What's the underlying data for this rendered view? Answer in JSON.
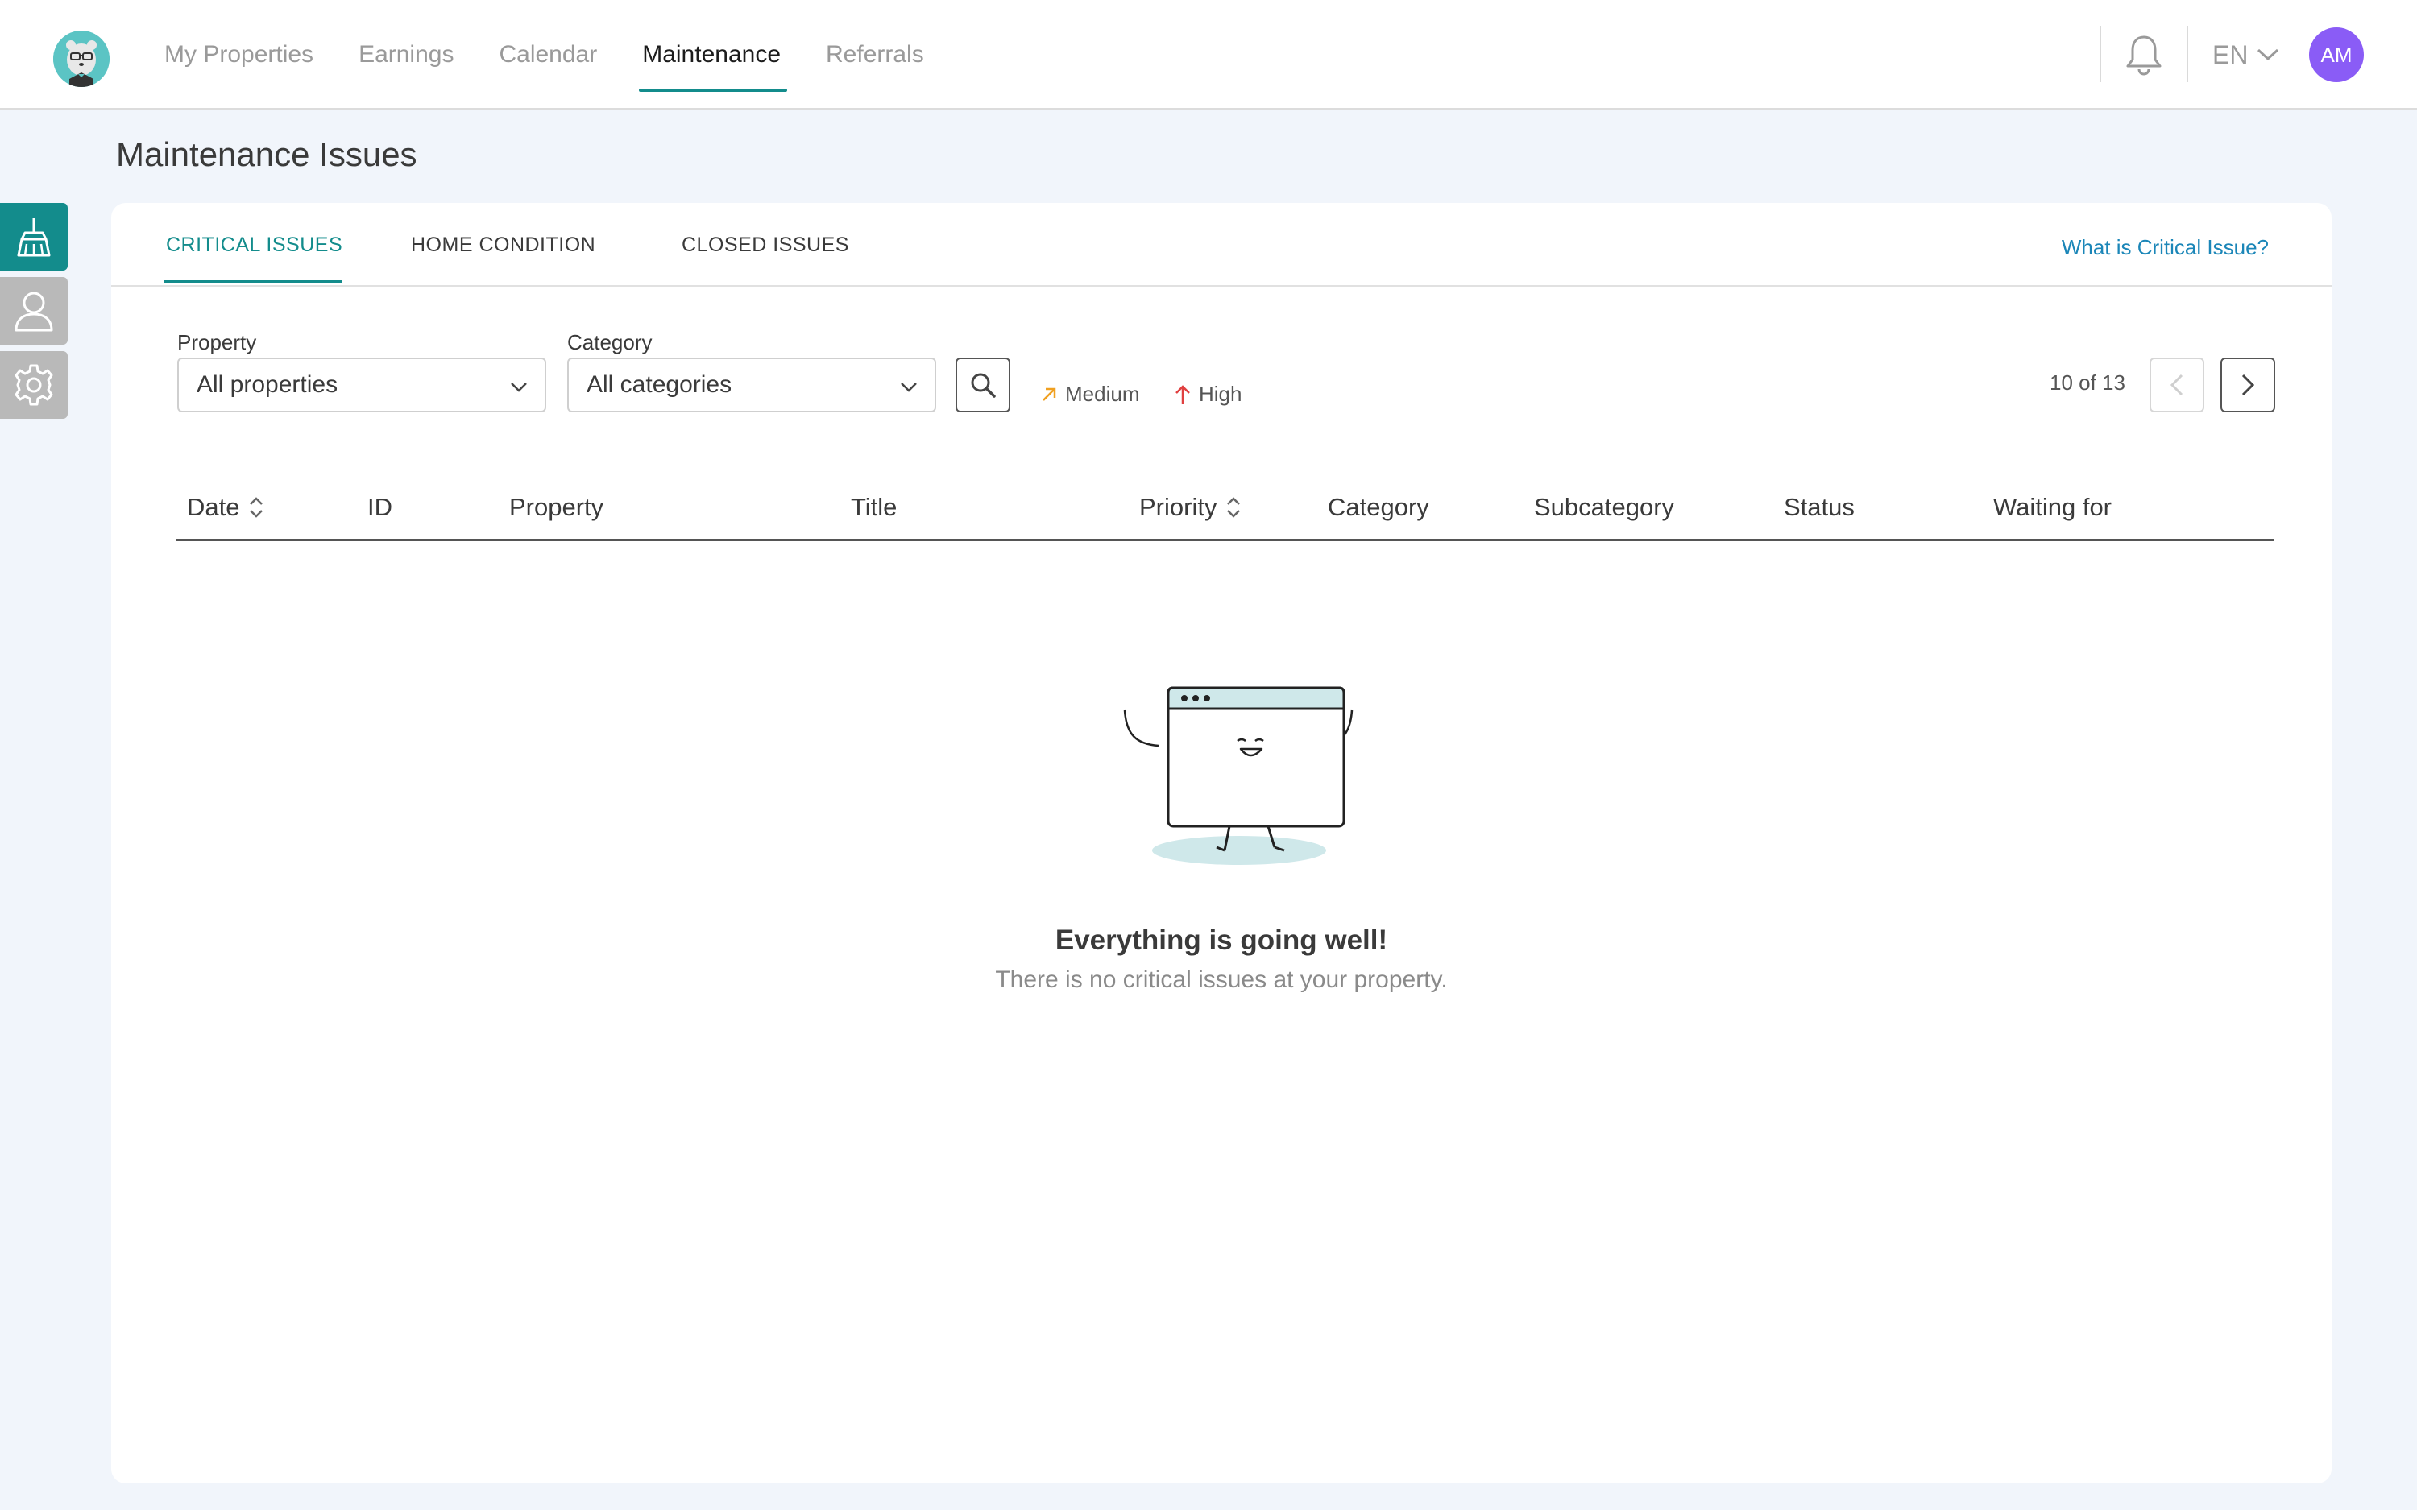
{
  "nav": {
    "items": [
      {
        "label": "My Properties",
        "active": false
      },
      {
        "label": "Earnings",
        "active": false
      },
      {
        "label": "Calendar",
        "active": false
      },
      {
        "label": "Maintenance",
        "active": true
      },
      {
        "label": "Referrals",
        "active": false
      }
    ],
    "language": "EN",
    "avatar_initials": "AM",
    "avatar_color": "#8a5cf6"
  },
  "sidebar": {
    "items": [
      {
        "icon": "broom-icon",
        "active": true
      },
      {
        "icon": "user-icon",
        "active": false
      },
      {
        "icon": "gear-icon",
        "active": false
      }
    ]
  },
  "page": {
    "title": "Maintenance Issues"
  },
  "tabs": [
    {
      "label": "CRITICAL ISSUES",
      "active": true
    },
    {
      "label": "HOME CONDITION",
      "active": false
    },
    {
      "label": "CLOSED ISSUES",
      "active": false
    }
  ],
  "help_link": "What is Critical Issue?",
  "filters": {
    "property_label": "Property",
    "property_value": "All properties",
    "category_label": "Category",
    "category_value": "All categories"
  },
  "legend": {
    "medium": "Medium",
    "high": "High",
    "medium_color": "#f0a020",
    "high_color": "#e04040"
  },
  "pager": {
    "text": "10 of 13"
  },
  "table": {
    "columns": [
      "Date",
      "ID",
      "Property",
      "Title",
      "Priority",
      "Category",
      "Subcategory",
      "Status",
      "Waiting for"
    ]
  },
  "empty": {
    "title": "Everything is going well!",
    "subtitle": "There is no critical issues at your property."
  },
  "colors": {
    "accent": "#138c8c",
    "link": "#1b86b8",
    "background": "#f1f5fb"
  }
}
